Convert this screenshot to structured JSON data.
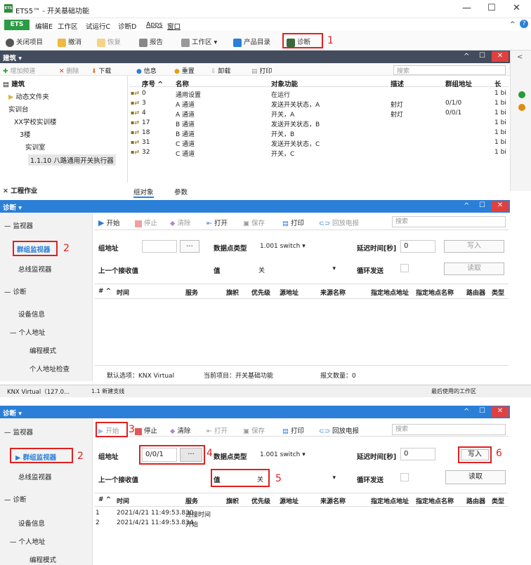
{
  "title": "ETS5™ - 开关基础功能",
  "app_icon": "ETS",
  "window_buttons": [
    "—",
    "☐",
    "✕"
  ],
  "menu": {
    "ets": "ETS",
    "items": [
      "编辑E",
      "工作区",
      "试运行C",
      "诊断D",
      "Apps",
      "窗口"
    ]
  },
  "toolbar": {
    "items": [
      "关闭项目",
      "撤消",
      "恢复",
      "报告",
      "工作区 ▾",
      "产品目录",
      "诊断"
    ],
    "annot1": "1"
  },
  "building": {
    "title": "建筑 ▾",
    "tools": [
      "增加频道",
      "删除",
      "下载",
      "信息",
      "重置",
      "卸载",
      "打印"
    ],
    "search": "搜索",
    "tree_title": "建筑",
    "tree": [
      "动态文件夹",
      "实训台",
      "XX学校实训楼",
      "3楼",
      "实训室",
      "1.1.10 八路通用开关执行器"
    ],
    "cols": [
      "序号 ^",
      "名称",
      "对象功能",
      "描述",
      "群组地址",
      "长"
    ],
    "rows": [
      [
        "0",
        "通用设置",
        "在运行",
        "",
        "",
        "1 bi"
      ],
      [
        "3",
        "A 通道",
        "发送开关状态，A",
        "射灯",
        "0/1/0",
        "1 bi"
      ],
      [
        "4",
        "A 通道",
        "开关，A",
        "射灯",
        "0/0/1",
        "1 bi"
      ],
      [
        "17",
        "B 通道",
        "发送开关状态，B",
        "",
        "",
        "1 bi"
      ],
      [
        "18",
        "B 通道",
        "开关，B",
        "",
        "",
        "1 bi"
      ],
      [
        "31",
        "C 通道",
        "发送开关状态，C",
        "",
        "",
        "1 bi"
      ],
      [
        "32",
        "C 通道",
        "开关，C",
        "",
        "",
        "1 bi"
      ]
    ],
    "tabs": [
      "组对象",
      "参数"
    ],
    "bottom": "工程作业"
  },
  "diag1": {
    "title": "诊断 ▾",
    "sidebar": [
      "监视器",
      "群组监视器",
      "总线监视器",
      "诊断",
      "设备信息",
      "个人地址",
      "编程模式",
      "个人地址检查"
    ],
    "annot2": "2",
    "tools": [
      "开始",
      "停止",
      "清除",
      "打开",
      "保存",
      "打印",
      "回放电报",
      "搜索"
    ],
    "group_address_label": "组地址",
    "group_address_value": "",
    "browse": "...",
    "dpt_label": "数据点类型",
    "dpt_value": "1.001 switch",
    "delay_label": "延迟时间[秒]",
    "delay_value": "0",
    "write": "写入",
    "read": "读取",
    "last_label": "上一个接收值",
    "value_label": "值",
    "value_value": "关",
    "cyclic_label": "循环发送",
    "cols": [
      "# ^",
      "时间",
      "服务",
      "旗帜",
      "优先级",
      "源地址",
      "来源名称",
      "指定地点地址",
      "指定地点名称",
      "路由器",
      "类型"
    ],
    "footer_default": "默认选项：KNX Virtual",
    "footer_project": "当前项目：开关基础功能",
    "footer_count": "报文数量：0"
  },
  "statusbar": {
    "left": "KNX Virtual（127.0...",
    "mid": "1.1 新建支线",
    "right": "最后使用的工作区"
  },
  "diag2": {
    "title": "诊断 ▾",
    "annots": [
      "2",
      "3",
      "4",
      "5",
      "6"
    ],
    "group_address_value": "0/0/1",
    "rows": [
      [
        "1",
        "2021/4/21 11:49:53.830",
        "连接时间"
      ],
      [
        "2",
        "2021/4/21 11:49:53.834",
        "开始"
      ]
    ]
  }
}
